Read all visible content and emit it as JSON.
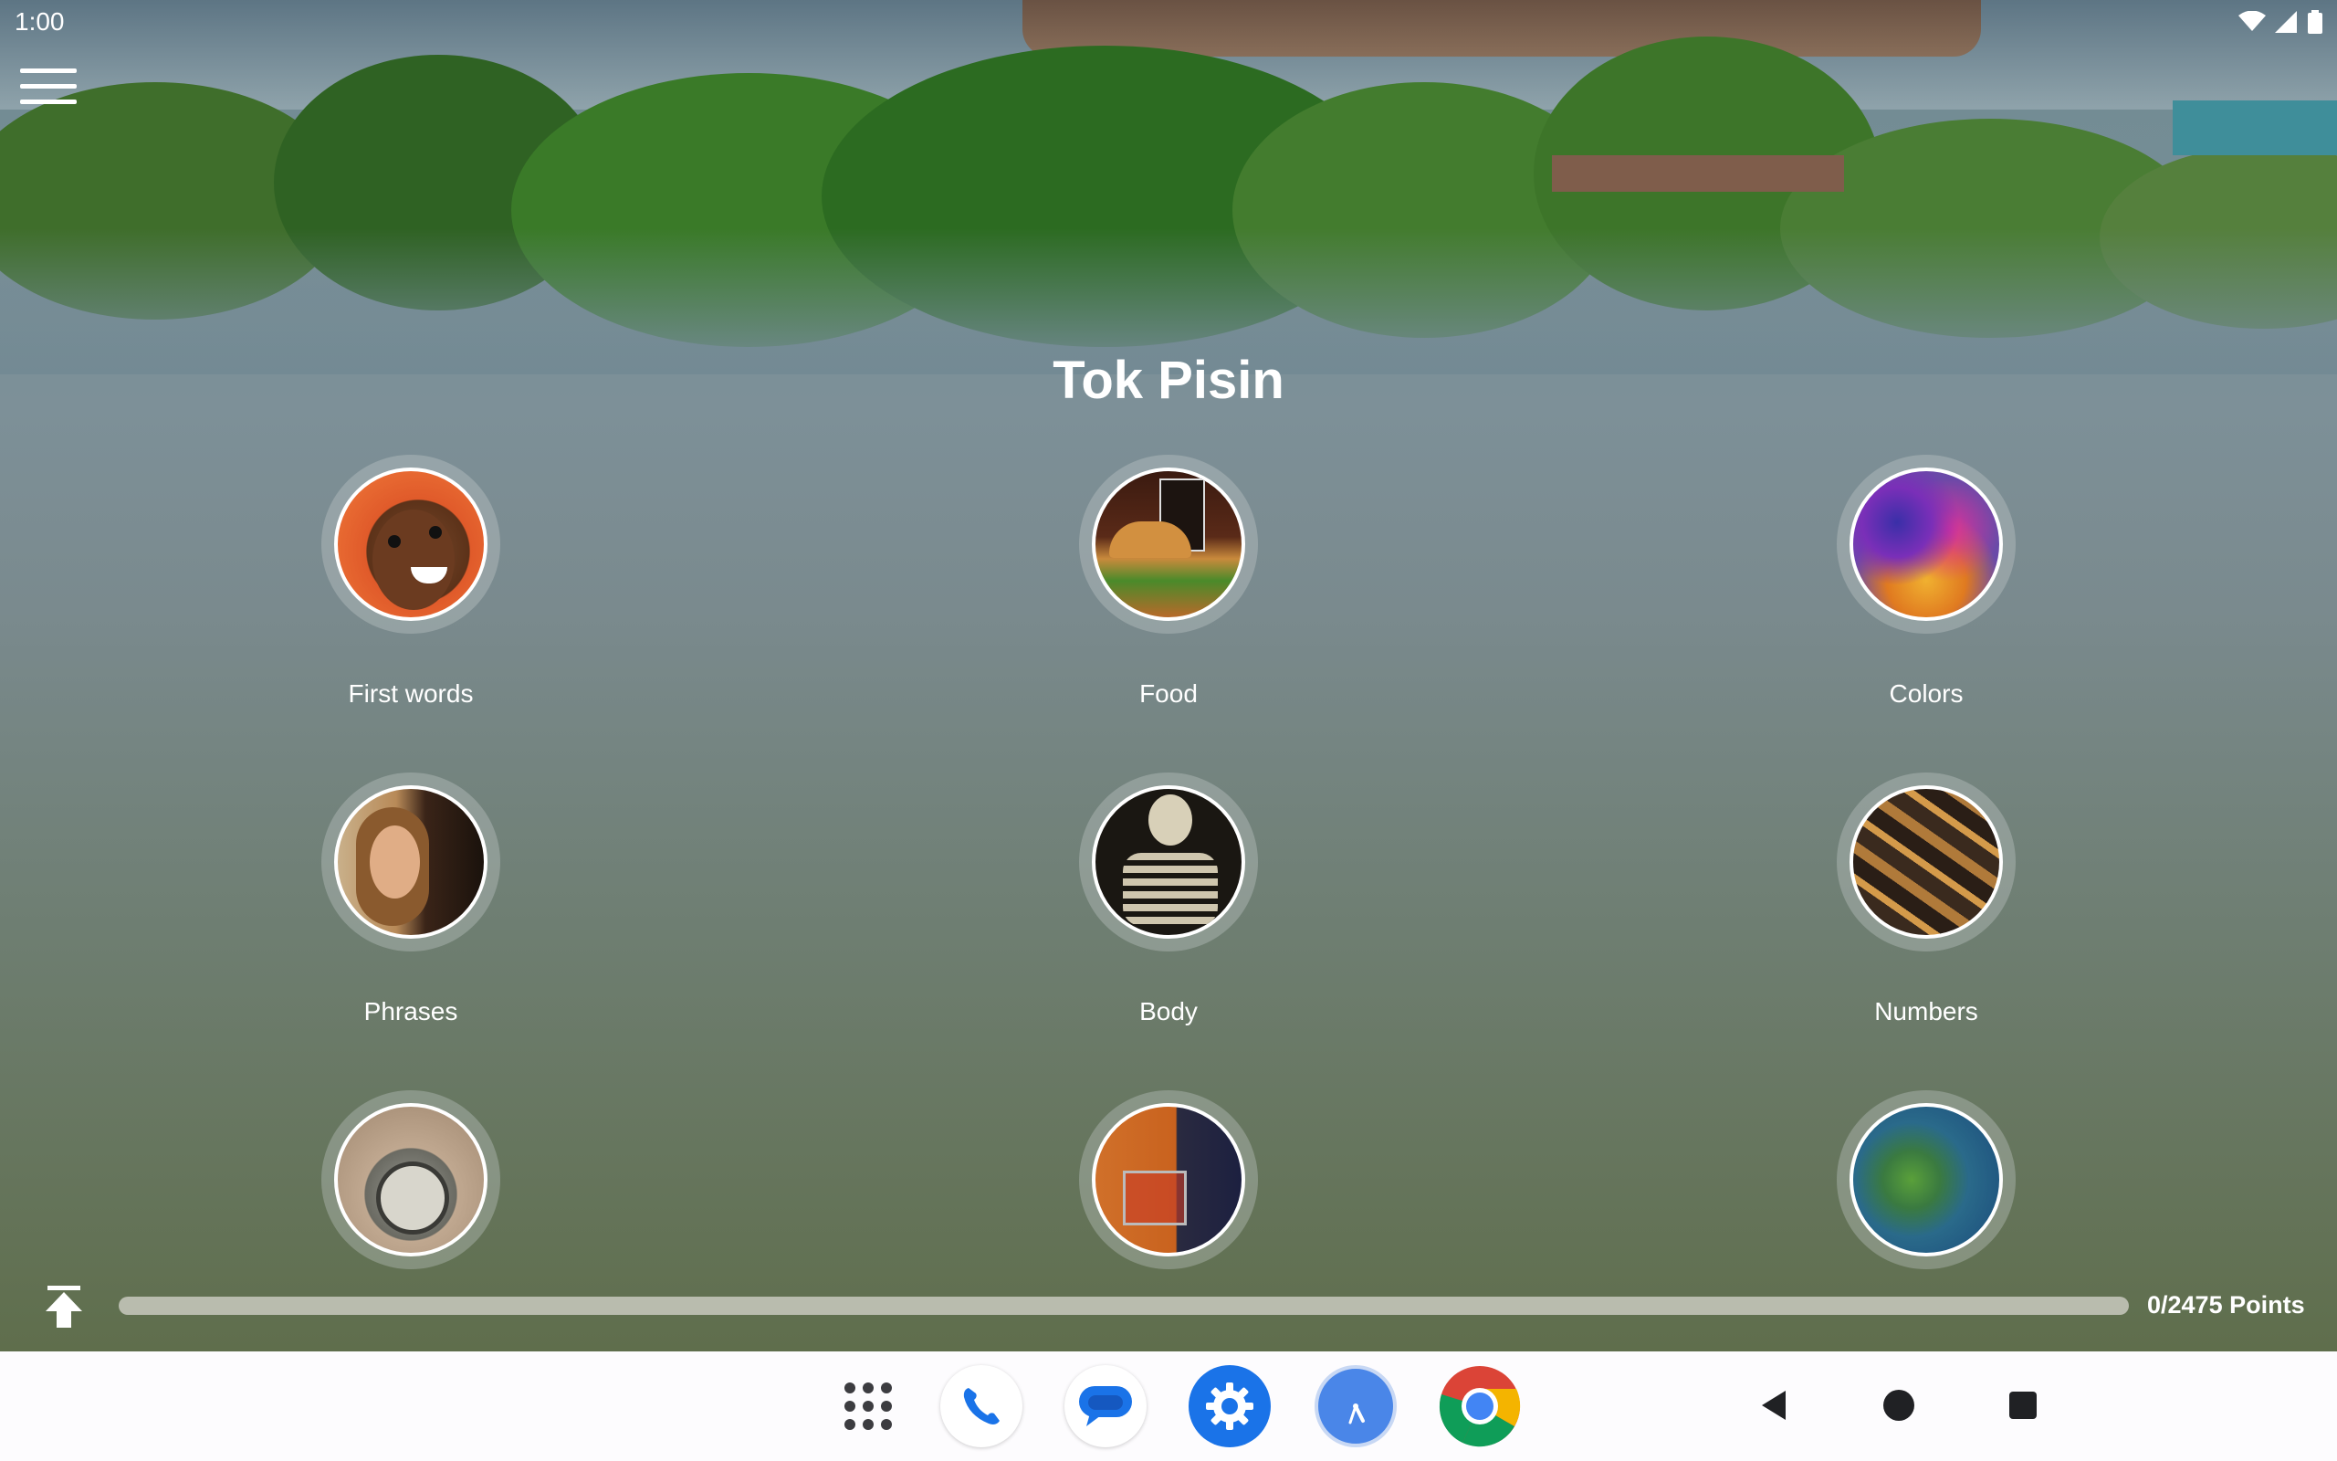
{
  "status_bar": {
    "time": "1:00"
  },
  "page": {
    "title": "Tok Pisin"
  },
  "categories": [
    {
      "label": "First words"
    },
    {
      "label": "Food"
    },
    {
      "label": "Colors"
    },
    {
      "label": "Phrases"
    },
    {
      "label": "Body"
    },
    {
      "label": "Numbers"
    },
    {
      "label": ""
    },
    {
      "label": ""
    },
    {
      "label": ""
    }
  ],
  "progress": {
    "points_label": "0/2475 Points",
    "value": 0,
    "total": 2475,
    "fill_color": "#4caf50",
    "track_color": "#b9bcae"
  },
  "dock": [
    {
      "icon": "app-drawer-icon"
    },
    {
      "icon": "phone-icon"
    },
    {
      "icon": "messages-icon"
    },
    {
      "icon": "settings-icon"
    },
    {
      "icon": "clock-icon"
    },
    {
      "icon": "chrome-icon"
    }
  ],
  "system_nav": [
    "back-icon",
    "home-icon",
    "recents-icon"
  ]
}
